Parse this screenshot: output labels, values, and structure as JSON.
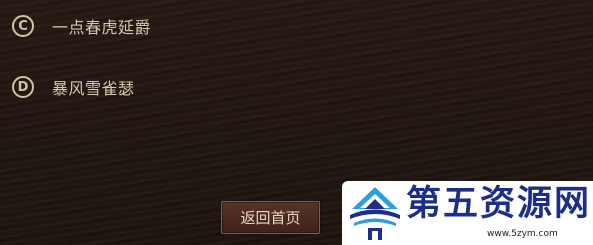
{
  "options": [
    {
      "letter": "C",
      "text": "一点春虎延爵"
    },
    {
      "letter": "D",
      "text": "暴风雪雀瑟"
    }
  ],
  "home_button": {
    "label": "返回首页"
  },
  "watermark": {
    "name": "第五资源网",
    "url": "www.5zym.com",
    "colors": {
      "brand": "#1d2e88",
      "light": "#2a9ee2"
    },
    "icon": "mountain-wave-logo-icon"
  },
  "colors": {
    "background": "#231611",
    "option_text": "#d8c7a8",
    "button_bg": "#4a2a1f",
    "button_border": "#8a5a44"
  }
}
